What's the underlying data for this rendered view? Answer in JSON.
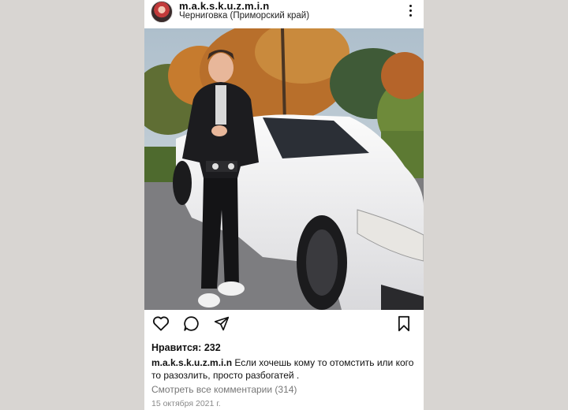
{
  "post": {
    "username": "m.a.k.s.k.u.z.m.i.n",
    "location": "Черниговка (Приморский край)",
    "likes_text": "Нравится: 232",
    "caption_username": "m.a.k.s.k.u.z.m.i.n",
    "caption_text": " Если хочешь кому то отомстить или кого то разозлить, просто разбогатей .",
    "view_comments": "Смотреть все комментарии (314)",
    "date": "15 октября 2021 г."
  },
  "icons": {
    "more": "more-vertical-icon",
    "like": "heart-icon",
    "comment": "comment-icon",
    "share": "share-icon",
    "save": "bookmark-icon"
  },
  "colors": {
    "background": "#d8d5d2",
    "card": "#ffffff",
    "muted_text": "#777777"
  }
}
